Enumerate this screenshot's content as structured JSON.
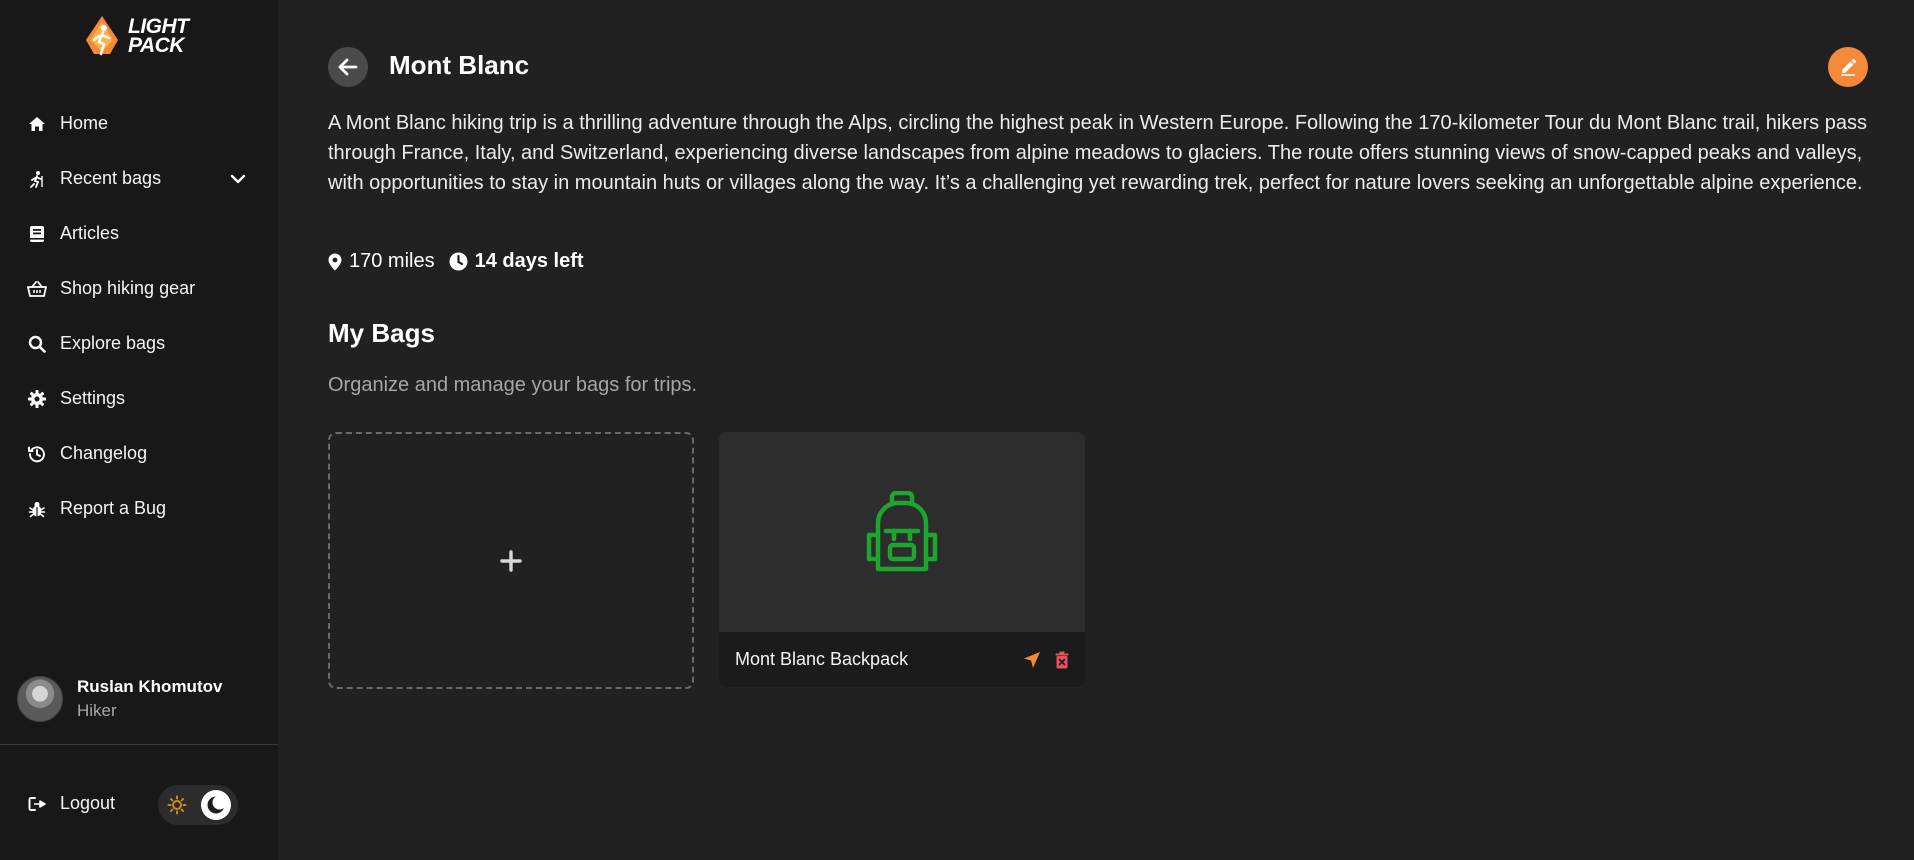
{
  "brand": {
    "line1": "LIGHT",
    "line2": "PACK",
    "accent": "#f5893a"
  },
  "sidebar": {
    "items": [
      {
        "label": "Home",
        "icon": "home-icon"
      },
      {
        "label": "Recent bags",
        "icon": "hiker-icon",
        "expandable": true
      },
      {
        "label": "Articles",
        "icon": "book-icon"
      },
      {
        "label": "Shop hiking gear",
        "icon": "basket-icon"
      },
      {
        "label": "Explore bags",
        "icon": "search-icon"
      },
      {
        "label": "Settings",
        "icon": "gear-icon"
      },
      {
        "label": "Changelog",
        "icon": "history-icon"
      },
      {
        "label": "Report a Bug",
        "icon": "bug-icon"
      }
    ],
    "profile": {
      "name": "Ruslan Khomutov",
      "role": "Hiker"
    },
    "logout_label": "Logout",
    "theme": {
      "mode": "dark"
    }
  },
  "trip": {
    "title": "Mont Blanc",
    "description": "A Mont Blanc hiking trip is a thrilling adventure through the Alps, circling the highest peak in Western Europe. Following the 170-kilometer Tour du Mont Blanc trail, hikers pass through France, Italy, and Switzerland, experiencing diverse landscapes from alpine meadows to glaciers. The route offers stunning views of snow-capped peaks and valleys, with opportunities to stay in mountain huts or villages along the way. It’s a challenging yet rewarding trek, perfect for nature lovers seeking an unforgettable alpine experience.",
    "distance": "170 miles",
    "days_left": "14 days left"
  },
  "bags_section": {
    "title": "My Bags",
    "subtitle": "Organize and manage your bags for trips.",
    "add_symbol": "+",
    "bags": [
      {
        "name": "Mont Blanc Backpack",
        "icon": "backpack-icon",
        "icon_color": "#1ea52e"
      }
    ]
  },
  "colors": {
    "background": "#212121",
    "sidebar": "#181818",
    "danger": "#e8505b"
  }
}
